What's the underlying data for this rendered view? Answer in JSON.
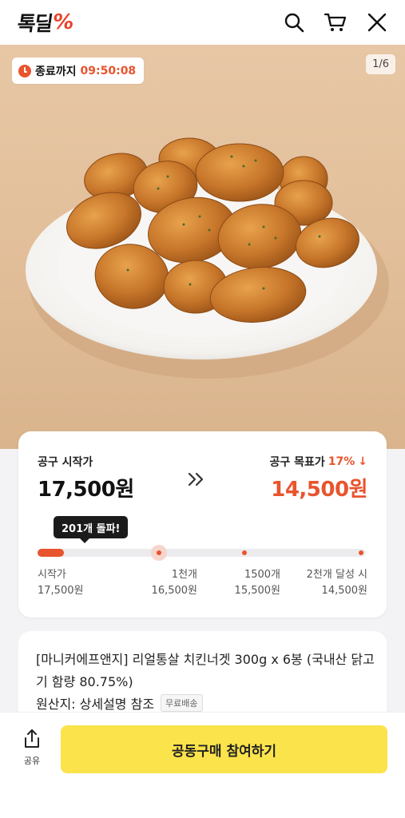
{
  "header": {
    "logo_text": "톡딜",
    "logo_mark": "%",
    "icons": [
      "search-icon",
      "cart-icon",
      "close-icon"
    ]
  },
  "hero": {
    "timer_label": "종료까지",
    "timer_value": "09:50:08",
    "image_counter": "1/6"
  },
  "price": {
    "start_label": "공구 시작가",
    "start_price": "17,500원",
    "target_label": "공구 목표가",
    "target_discount": "17%",
    "target_arrow": "↓",
    "target_price": "14,500원",
    "tooltip": "201개 돌파!",
    "progress_fraction": 0.08,
    "tiers": [
      {
        "label": "시작가",
        "price": "17,500원"
      },
      {
        "label": "1천개",
        "price": "16,500원"
      },
      {
        "label": "1500개",
        "price": "15,500원"
      },
      {
        "label": "2천개 달성 시",
        "price": "14,500원"
      }
    ]
  },
  "product": {
    "title": "[마니커에프앤지] 리얼통살 치킨너겟 300g x 6봉 (국내산 닭고기 함량 80.75%)",
    "origin": "원산지: 상세설명 참조",
    "badge": "무료배송"
  },
  "bottom": {
    "share_label": "공유",
    "join_label": "공동구매 참여하기"
  },
  "colors": {
    "accent": "#e8542e",
    "button": "#fbe34b"
  }
}
